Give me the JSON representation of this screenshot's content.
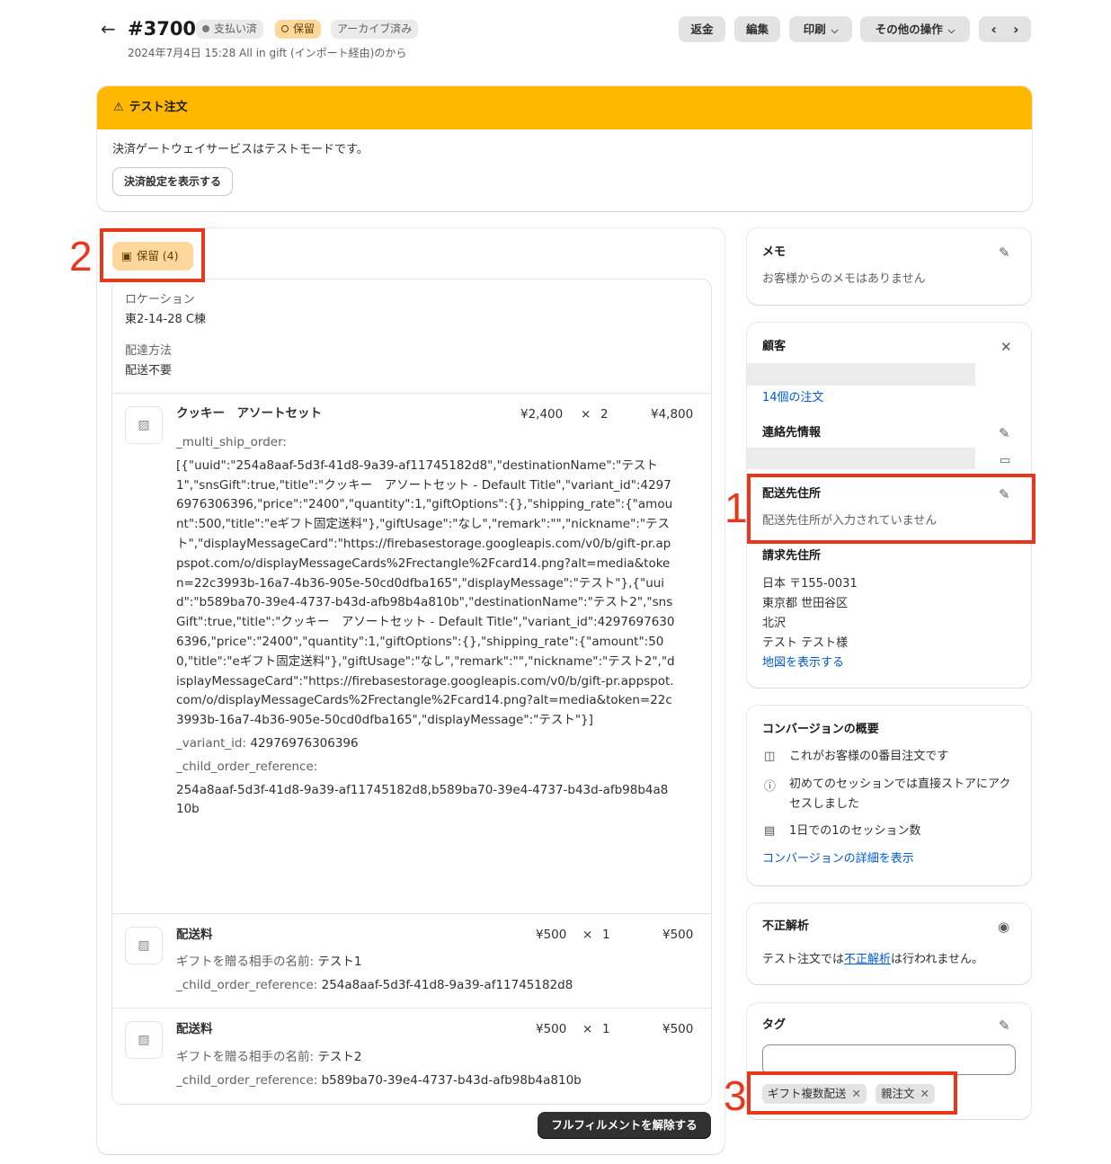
{
  "header": {
    "back_icon": "arrow-left-icon",
    "order_number": "#3700",
    "badges": {
      "paid": "支払い済",
      "hold": "保留",
      "archived": "アーカイブ済み"
    },
    "subtitle": "2024年7月4日 15:28 All in gift (インポート経由)のから",
    "actions": {
      "refund": "返金",
      "edit": "編集",
      "print": "印刷",
      "more": "その他の操作"
    },
    "nav": {
      "prev": "‹",
      "next": "›"
    }
  },
  "test_banner": {
    "title": "テスト注文",
    "message": "決済ゲートウェイサービスはテストモードです。",
    "button": "決済設定を表示する"
  },
  "annotations": [
    "1",
    "2",
    "3"
  ],
  "fulfillment": {
    "hold_badge": "保留 (4)",
    "location_label": "ロケーション",
    "location_value": "東2-14-28 C棟",
    "delivery_label": "配達方法",
    "delivery_value": "配送不要",
    "items": [
      {
        "name": "クッキー　アソートセット",
        "price": "¥2,400",
        "times": "×",
        "qty": "2",
        "total": "¥4,800",
        "prop_key_1": "_multi_ship_order:",
        "prop_val_1": "[{\"uuid\":\"254a8aaf-5d3f-41d8-9a39-af11745182d8\",\"destinationName\":\"テスト1\",\"snsGift\":true,\"title\":\"クッキー　アソートセット - Default Title\",\"variant_id\":42976976306396,\"price\":\"2400\",\"quantity\":1,\"giftOptions\":{},\"shipping_rate\":{\"amount\":500,\"title\":\"eギフト固定送料\"},\"giftUsage\":\"なし\",\"remark\":\"\",\"nickname\":\"テスト\",\"displayMessageCard\":\"https://firebasestorage.googleapis.com/v0/b/gift-pr.appspot.com/o/displayMessageCards%2Frectangle%2Fcard14.png?alt=media&token=22c3993b-16a7-4b36-905e-50cd0dfba165\",\"displayMessage\":\"テスト\"},{\"uuid\":\"b589ba70-39e4-4737-b43d-afb98b4a810b\",\"destinationName\":\"テスト2\",\"snsGift\":true,\"title\":\"クッキー　アソートセット - Default Title\",\"variant_id\":42976976306396,\"price\":\"2400\",\"quantity\":1,\"giftOptions\":{},\"shipping_rate\":{\"amount\":500,\"title\":\"eギフト固定送料\"},\"giftUsage\":\"なし\",\"remark\":\"\",\"nickname\":\"テスト2\",\"displayMessageCard\":\"https://firebasestorage.googleapis.com/v0/b/gift-pr.appspot.com/o/displayMessageCards%2Frectangle%2Fcard14.png?alt=media&token=22c3993b-16a7-4b36-905e-50cd0dfba165\",\"displayMessage\":\"テスト\"}]",
        "prop_key_2": "_variant_id:",
        "prop_val_2": "42976976306396",
        "prop_key_3": "_child_order_reference:",
        "prop_val_3": "254a8aaf-5d3f-41d8-9a39-af11745182d8,b589ba70-39e4-4737-b43d-afb98b4a810b"
      },
      {
        "name": "配送料",
        "price": "¥500",
        "times": "×",
        "qty": "1",
        "total": "¥500",
        "prop_key_1": "ギフトを贈る相手の名前:",
        "prop_val_1": "テスト1",
        "prop_key_2": "_child_order_reference:",
        "prop_val_2": "254a8aaf-5d3f-41d8-9a39-af11745182d8"
      },
      {
        "name": "配送料",
        "price": "¥500",
        "times": "×",
        "qty": "1",
        "total": "¥500",
        "prop_key_1": "ギフトを贈る相手の名前:",
        "prop_val_1": "テスト2",
        "prop_key_2": "_child_order_reference:",
        "prop_val_2": "b589ba70-39e4-4737-b43d-afb98b4a810b"
      }
    ],
    "release_button": "フルフィルメントを解除する"
  },
  "memo": {
    "title": "メモ",
    "text": "お客様からのメモはありません"
  },
  "customer": {
    "title": "顧客",
    "orders_link": "14個の注文",
    "contact_title": "連絡先情報",
    "shipping_title": "配送先住所",
    "shipping_text": "配送先住所が入力されていません",
    "billing_title": "請求先住所",
    "billing_lines": [
      "日本 〒155-0031",
      "東京都 世田谷区",
      "北沢",
      "テスト テスト様"
    ],
    "map_link": "地図を表示する"
  },
  "conversion": {
    "title": "コンバージョンの概要",
    "line1": "これがお客様の0番目注文です",
    "line2": "初めてのセッションでは直接ストアにアクセスしました",
    "line3": "1日での1のセッション数",
    "link": "コンバージョンの詳細を表示"
  },
  "fraud": {
    "title": "不正解析",
    "text_before": "テスト注文では",
    "text_link": "不正解析",
    "text_after": "は行われません。"
  },
  "tags": {
    "title": "タグ",
    "input_value": "",
    "items": [
      "ギフト複数配送",
      "親注文"
    ]
  }
}
